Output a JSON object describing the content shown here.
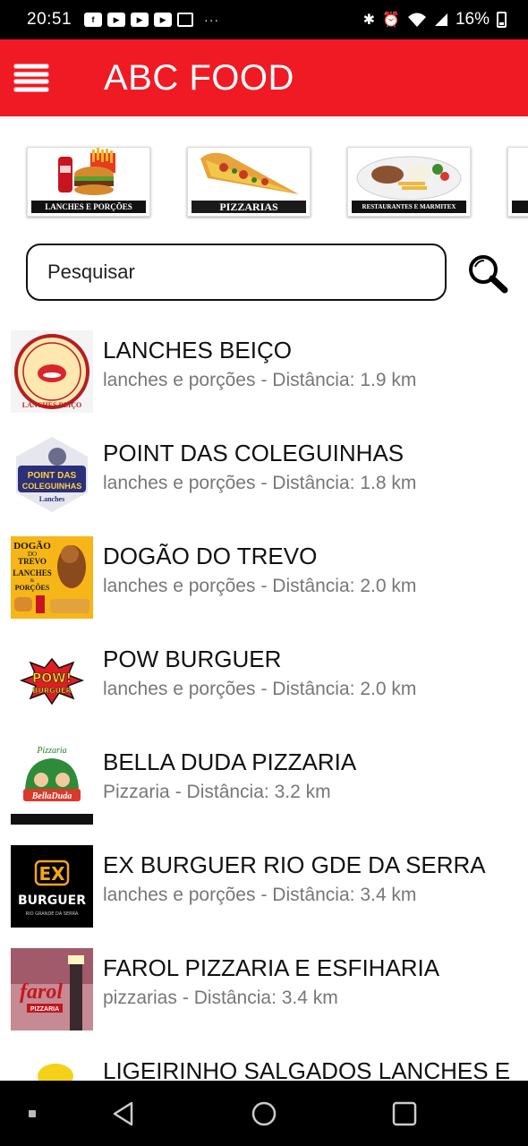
{
  "status_bar": {
    "time": "20:51",
    "overflow": "···",
    "battery": "16%"
  },
  "app_bar": {
    "title": "ABC FOOD"
  },
  "categories": [
    {
      "label": "LANCHES E PORÇÕES"
    },
    {
      "label": "PIZZARIAS"
    },
    {
      "label": "RESTAURANTES E MARMITEX"
    }
  ],
  "search": {
    "placeholder": "Pesquisar"
  },
  "restaurants": [
    {
      "name": "LANCHES BEIÇO",
      "category": "lanches e porções",
      "distance": "- Distância: 1.9 km"
    },
    {
      "name": "POINT DAS COLEGUINHAS",
      "category": "lanches e porções",
      "distance": "- Distância: 1.8 km"
    },
    {
      "name": "DOGÃO DO TREVO",
      "category": "lanches e porções",
      "distance": "- Distância: 2.0 km"
    },
    {
      "name": "POW BURGUER",
      "category": "lanches e porções",
      "distance": "- Distância: 2.0 km"
    },
    {
      "name": "BELLA DUDA PIZZARIA",
      "category": "Pizzaria",
      "distance": "- Distância: 3.2 km"
    },
    {
      "name": "EX BURGUER RIO GDE DA SERRA",
      "category": "lanches e porções",
      "distance": "- Distância: 3.4 km"
    },
    {
      "name": "FAROL PIZZARIA E ESFIHARIA",
      "category": "pizzarias",
      "distance": "- Distância: 3.4 km"
    },
    {
      "name": "LIGEIRINHO SALGADOS LANCHES E",
      "category": "",
      "distance": ""
    }
  ],
  "logos": {
    "lanches_beico": "LANCHES BEIÇO",
    "point": [
      "POINT DAS",
      "COLEGUINHAS",
      "Lanches"
    ],
    "dogao": [
      "DOGÃO",
      "DO",
      "TREVO",
      "LANCHES",
      "&",
      "PORÇÕES"
    ],
    "pow": [
      "POW!",
      "BURGUER"
    ],
    "bella": [
      "Pizzaria",
      "BellaDuda"
    ],
    "ex": [
      "EX",
      "BURGUER",
      "RIO GRANDE DA SERRA"
    ],
    "farol": [
      "farol",
      "PIZZARIA"
    ]
  },
  "colors": {
    "app_bar": "#f01a24",
    "status_bar": "#000000",
    "text_primary": "#111111",
    "text_secondary": "#777777"
  }
}
